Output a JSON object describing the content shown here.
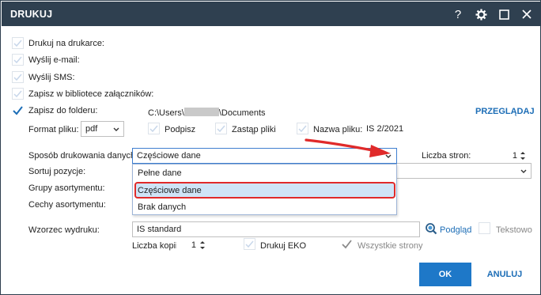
{
  "window": {
    "title": "DRUKUJ",
    "icons": [
      "help-icon",
      "gear-icon",
      "maximize-icon",
      "close-icon"
    ]
  },
  "options": {
    "print_on_printer": "Drukuj na drukarce:",
    "send_email": "Wyślij e-mail:",
    "send_sms": "Wyślij SMS:",
    "save_attachments": "Zapisz w bibliotece załączników:",
    "save_to_folder": "Zapisz do folderu:"
  },
  "folder": {
    "path_prefix": "C:\\Users\\",
    "path_suffix": "\\Documents",
    "browse_label": "PRZEGLĄDAJ"
  },
  "file": {
    "format_label": "Format pliku:",
    "format_value": "pdf",
    "sign_label": "Podpisz",
    "replace_label": "Zastąp pliki",
    "name_label": "Nazwa pliku:",
    "name_value": "IS 2/2021"
  },
  "print_method": {
    "label": "Sposób drukowania danych:",
    "value": "Częściowe dane",
    "options": [
      "Pełne dane",
      "Częściowe dane",
      "Brak danych"
    ],
    "selected_index": 1
  },
  "pages": {
    "label": "Liczba stron:",
    "value": "1"
  },
  "fields": {
    "sort_label": "Sortuj pozycje:",
    "groups_label": "Grupy asortymentu:",
    "features_label": "Cechy asortymentu:"
  },
  "template": {
    "label": "Wzorzec wydruku:",
    "value": "IS standard",
    "preview_label": "Podgląd",
    "text_label": "Tekstowo"
  },
  "copies": {
    "label": "Liczba kopii:",
    "value": "1",
    "eko_label": "Drukuj EKO",
    "all_pages_label": "Wszystkie strony"
  },
  "buttons": {
    "ok": "OK",
    "cancel": "ANULUJ"
  },
  "colors": {
    "titlebar": "#2f4050",
    "accent": "#1c6db6",
    "ok_button": "#1e78c8",
    "highlight": "#cfe4f7",
    "annotation_red": "#e02a2a"
  }
}
